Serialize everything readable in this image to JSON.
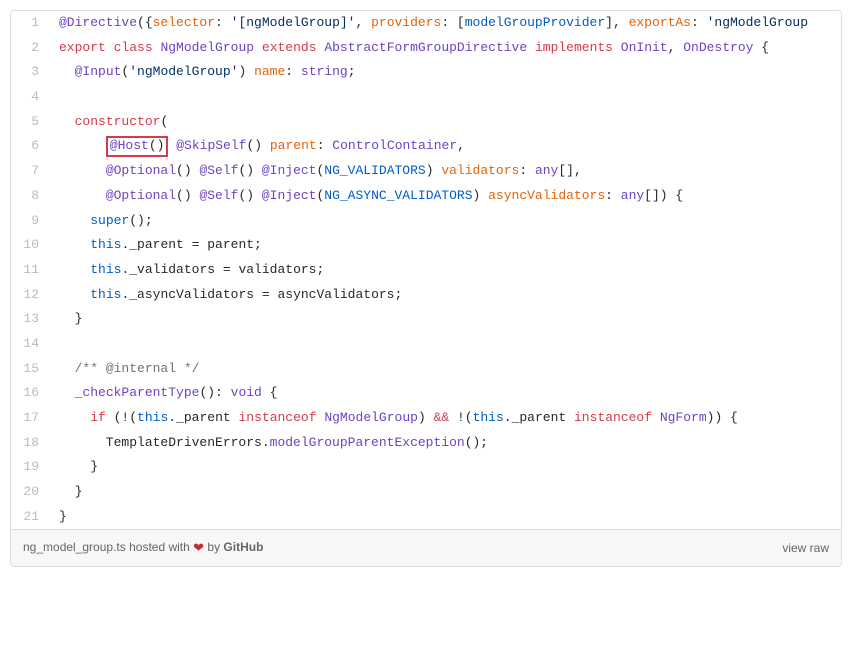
{
  "filename": "ng_model_group.ts",
  "hosted_txt_before": " hosted with ",
  "hosted_txt_after": " by ",
  "host_name": "GitHub",
  "view_raw": "view raw",
  "highlight_line": 6,
  "highlight_text": "@Host()",
  "lines": [
    {
      "n": 1,
      "html": "<span class='c-dec'>@Directive</span>({<span class='c-id'>selector</span>: <span class='c-str'>'[ngModelGroup]'</span>, <span class='c-id'>providers</span>: [<span class='c-blue'>modelGroupProvider</span>], <span class='c-id'>exportAs</span>: <span class='c-str'>'ngModelGroup</span>"
    },
    {
      "n": 2,
      "html": "<span class='c-kw'>export</span> <span class='c-kw'>class</span> <span class='c-fn'>NgModelGroup</span> <span class='c-kw'>extends</span> <span class='c-fn'>AbstractFormGroupDirective</span> <span class='c-kw'>implements</span> <span class='c-fn'>OnInit</span>, <span class='c-fn'>OnDestroy</span> {"
    },
    {
      "n": 3,
      "html": "  <span class='c-dec'>@Input</span>(<span class='c-str'>'ngModelGroup'</span>) <span class='c-id'>name</span>: <span class='c-type'>string</span>;"
    },
    {
      "n": 4,
      "html": ""
    },
    {
      "n": 5,
      "html": "  <span class='c-kw'>constructor</span>("
    },
    {
      "n": 6,
      "html": "      <span class='hl'><span class='c-dec'>@Host</span>()</span> <span class='c-dec'>@SkipSelf</span>() <span class='c-id'>parent</span>: <span class='c-type'>ControlContainer</span>,"
    },
    {
      "n": 7,
      "html": "      <span class='c-dec'>@Optional</span>() <span class='c-dec'>@Self</span>() <span class='c-dec'>@Inject</span>(<span class='c-blue'>NG_VALIDATORS</span>) <span class='c-id'>validators</span>: <span class='c-type'>any</span>[],"
    },
    {
      "n": 8,
      "html": "      <span class='c-dec'>@Optional</span>() <span class='c-dec'>@Self</span>() <span class='c-dec'>@Inject</span>(<span class='c-blue'>NG_ASYNC_VALIDATORS</span>) <span class='c-id'>asyncValidators</span>: <span class='c-type'>any</span>[]) {"
    },
    {
      "n": 9,
      "html": "    <span class='c-blue'>super</span>();"
    },
    {
      "n": 10,
      "html": "    <span class='c-blue'>this</span>._parent = parent;"
    },
    {
      "n": 11,
      "html": "    <span class='c-blue'>this</span>._validators = validators;"
    },
    {
      "n": 12,
      "html": "    <span class='c-blue'>this</span>._asyncValidators = asyncValidators;"
    },
    {
      "n": 13,
      "html": "  }"
    },
    {
      "n": 14,
      "html": ""
    },
    {
      "n": 15,
      "html": "  <span class='c-cmt'>/** @internal */</span>"
    },
    {
      "n": 16,
      "html": "  <span class='c-fn'>_checkParentType</span>(): <span class='c-type'>void</span> {"
    },
    {
      "n": 17,
      "html": "    <span class='c-kw'>if</span> (!(<span class='c-blue'>this</span>._parent <span class='c-kw'>instanceof</span> <span class='c-fn'>NgModelGroup</span>) <span class='c-kw'>&amp;&amp;</span> !(<span class='c-blue'>this</span>._parent <span class='c-kw'>instanceof</span> <span class='c-fn'>NgForm</span>)) {"
    },
    {
      "n": 18,
      "html": "      TemplateDrivenErrors.<span class='c-fn'>modelGroupParentException</span>();"
    },
    {
      "n": 19,
      "html": "    }"
    },
    {
      "n": 20,
      "html": "  }"
    },
    {
      "n": 21,
      "html": "}"
    }
  ]
}
